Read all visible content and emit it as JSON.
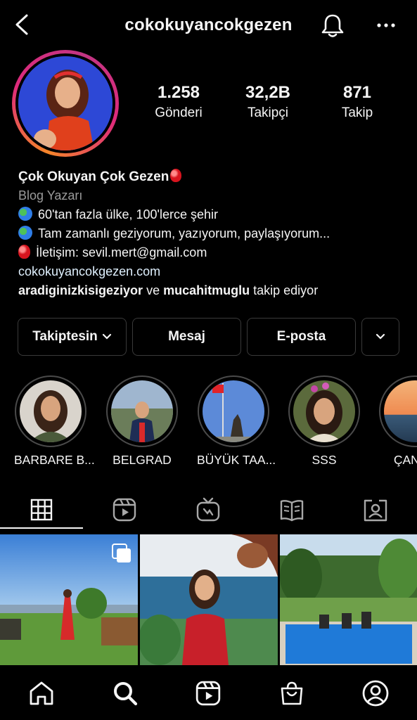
{
  "header": {
    "username": "cokokuyancokgezen"
  },
  "stats": [
    {
      "value": "1.258",
      "label": "Gönderi"
    },
    {
      "value": "32,2B",
      "label": "Takipçi"
    },
    {
      "value": "871",
      "label": "Takip"
    }
  ],
  "bio": {
    "name": "Çok Okuyan Çok Gezen",
    "category": "Blog Yazarı",
    "line1": "60'tan fazla ülke, 100'lerce şehir",
    "line2": "Tam zamanlı geziyorum, yazıyorum, paylaşıyorum...",
    "line3": "İletişim: sevil.mert@gmail.com",
    "website": "cokokuyancokgezen.com",
    "followed_by_1": "aradiginizkisigeziyor",
    "followed_by_joiner": "ve",
    "followed_by_2": "mucahitmuglu",
    "followed_by_suffix": "takip ediyor"
  },
  "buttons": {
    "following": "Takiptesin",
    "message": "Mesaj",
    "email": "E-posta"
  },
  "highlights": [
    {
      "label": "BARBARE B..."
    },
    {
      "label": "BELGRAD"
    },
    {
      "label": "BÜYÜK TAA..."
    },
    {
      "label": "SSS"
    },
    {
      "label": "ÇANAK"
    }
  ],
  "tabs": [
    {
      "icon": "grid-icon"
    },
    {
      "icon": "reels-icon"
    },
    {
      "icon": "igtv-icon"
    },
    {
      "icon": "guides-icon"
    },
    {
      "icon": "tagged-icon"
    }
  ],
  "bottom_nav": [
    {
      "icon": "home-icon"
    },
    {
      "icon": "search-icon"
    },
    {
      "icon": "reels-icon"
    },
    {
      "icon": "shop-icon"
    },
    {
      "icon": "profile-icon"
    }
  ],
  "colors": {
    "background": "#000000",
    "text": "#f5f5f5",
    "muted": "#9a9a9a",
    "link": "#e0f1ff",
    "story_ring": "#dd2a7b",
    "button_border": "#3a3a3a"
  }
}
